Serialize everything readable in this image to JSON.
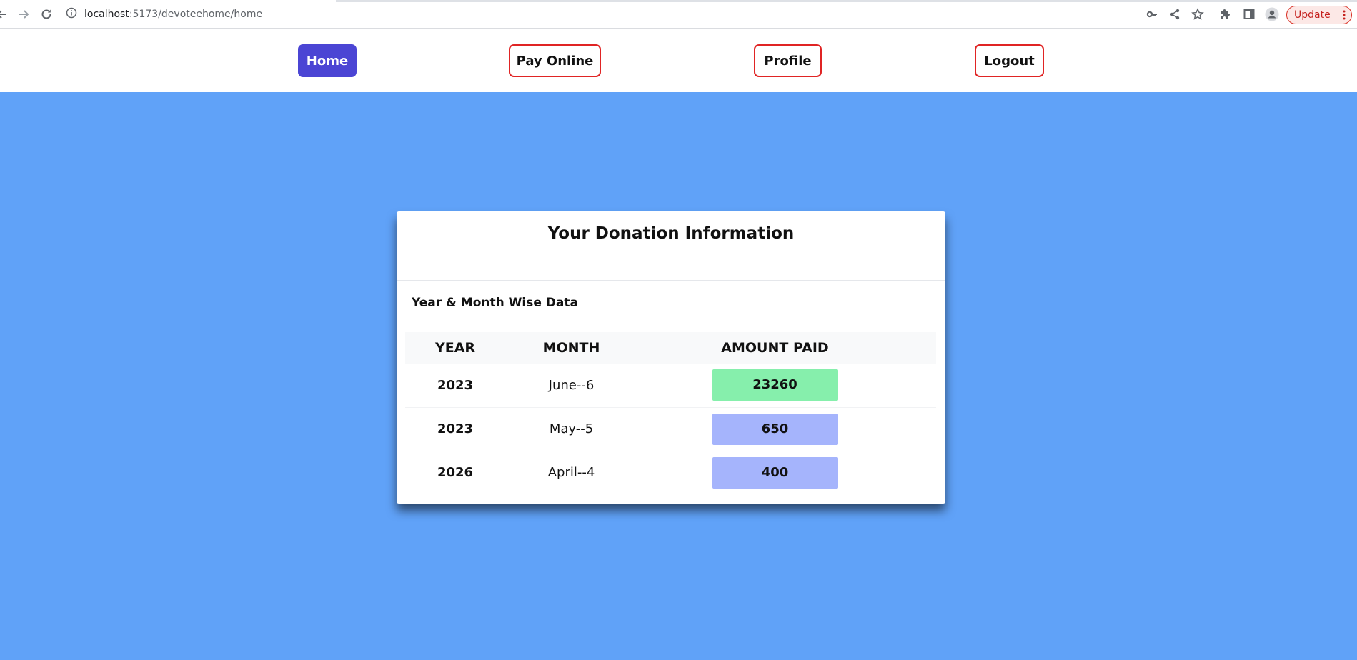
{
  "browser": {
    "url_host": "localhost",
    "url_rest": ":5173/devoteehome/home",
    "update_label": "Update"
  },
  "nav": {
    "items": [
      {
        "label": "Home",
        "active": true
      },
      {
        "label": "Pay Online",
        "active": false
      },
      {
        "label": "Profile",
        "active": false
      },
      {
        "label": "Logout",
        "active": false
      }
    ]
  },
  "card": {
    "title": "Your Donation Information",
    "subtitle": "Year & Month Wise Data",
    "columns": [
      "YEAR",
      "MONTH",
      "AMOUNT PAID"
    ],
    "rows": [
      {
        "year": "2023",
        "month": "June--6",
        "amount": "23260",
        "badge_color": "#86efac"
      },
      {
        "year": "2023",
        "month": "May--5",
        "amount": "650",
        "badge_color": "#a5b4fc"
      },
      {
        "year": "2026",
        "month": "April--4",
        "amount": "400",
        "badge_color": "#a5b4fc"
      }
    ]
  },
  "colors": {
    "background": "#60a2f8",
    "nav_active": "#4b45d4",
    "nav_border": "#e02424"
  }
}
